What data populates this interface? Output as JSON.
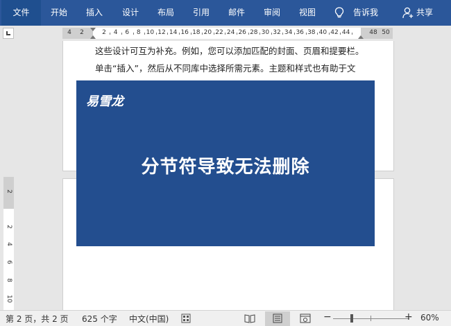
{
  "ribbon": {
    "tabs": [
      {
        "label": "文件"
      },
      {
        "label": "开始"
      },
      {
        "label": "插入"
      },
      {
        "label": "设计"
      },
      {
        "label": "布局"
      },
      {
        "label": "引用"
      },
      {
        "label": "邮件"
      },
      {
        "label": "审阅"
      },
      {
        "label": "视图"
      }
    ],
    "tell_me": "告诉我",
    "share": "共享"
  },
  "ruler": {
    "left_labels": [
      "4",
      "2"
    ],
    "numbers": [
      "2",
      "4",
      "6",
      "8",
      "10",
      "12",
      "14",
      "16",
      "18",
      "20",
      "22",
      "24",
      "26",
      "28",
      "30",
      "32",
      "34",
      "36",
      "38",
      "40",
      "42",
      "44"
    ],
    "right_labels": [
      "48",
      "50"
    ],
    "vertical_labels": [
      "2",
      "2",
      "4",
      "6",
      "8",
      "10"
    ]
  },
  "document": {
    "lines": [
      "这些设计可互为补充。例如，您可以添加匹配的封面、页眉和提要栏。",
      "单击“插入”，然后从不同库中选择所需元素。主题和样式也有助于文"
    ]
  },
  "banner": {
    "logo": "易雪龙",
    "title": "分节符导致无法删除",
    "background": "#234e8f"
  },
  "status": {
    "page": "第 2 页，共 2 页",
    "words": "625 个字",
    "language": "中文(中国)",
    "zoom_minus": "−",
    "zoom_plus": "+",
    "zoom": "60%"
  },
  "colors": {
    "ribbon": "#2b579a",
    "file_tab": "#1f4f8f"
  }
}
